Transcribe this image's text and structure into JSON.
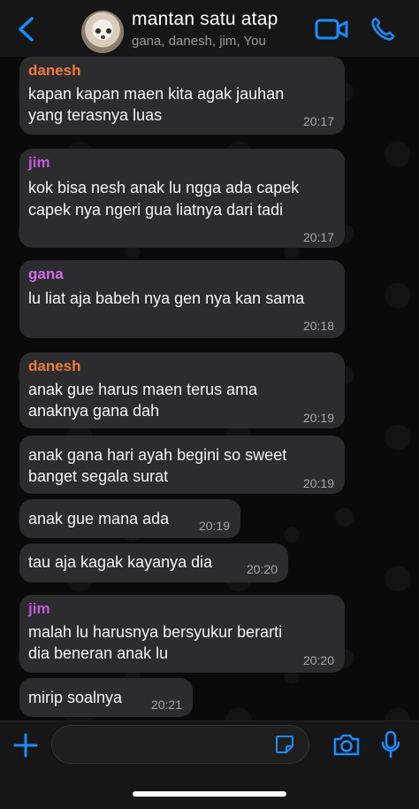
{
  "header": {
    "back_icon": "chevron-left-icon",
    "title": "mantan satu atap",
    "subtitle": "gana, danesh, jim, You",
    "video_icon": "video-call-icon",
    "call_icon": "phone-icon",
    "accent": "#1a8cff"
  },
  "messages": [
    {
      "sender": "danesh",
      "sender_color": "#f07a3d",
      "lines": [
        "kapan kapan maen kita agak jauhan",
        "yang terasnya luas"
      ],
      "time": "20:17"
    },
    {
      "sender": "jim",
      "sender_color": "#c15bd6",
      "lines": [
        "kok bisa nesh anak lu ngga ada capek",
        "capek nya ngeri gua liatnya dari tadi"
      ],
      "time": "20:17"
    },
    {
      "sender": "gana",
      "sender_color": "#d46be8",
      "lines": [
        "lu liat aja babeh nya gen nya kan sama"
      ],
      "time": "20:18"
    },
    {
      "sender": "danesh",
      "sender_color": "#f07a3d",
      "lines": [
        "anak gue harus maen terus ama",
        "anaknya gana dah"
      ],
      "time": "20:19"
    },
    {
      "sender": "",
      "sender_color": "",
      "lines": [
        "anak gana hari ayah begini so sweet",
        "banget segala surat"
      ],
      "time": "20:19"
    },
    {
      "sender": "",
      "sender_color": "",
      "lines": [
        "anak gue mana ada"
      ],
      "time": "20:19"
    },
    {
      "sender": "",
      "sender_color": "",
      "lines": [
        "tau aja kagak kayanya dia"
      ],
      "time": "20:20"
    },
    {
      "sender": "jim",
      "sender_color": "#c15bd6",
      "lines": [
        "malah lu harusnya bersyukur berarti",
        "dia beneran anak lu"
      ],
      "time": "20:20"
    },
    {
      "sender": "",
      "sender_color": "",
      "lines": [
        "mirip soalnya"
      ],
      "time": "20:21"
    }
  ],
  "composer": {
    "value": "",
    "placeholder": "",
    "plus_icon": "plus-icon",
    "sticker_icon": "sticker-icon",
    "camera_icon": "camera-icon",
    "mic_icon": "microphone-icon"
  }
}
